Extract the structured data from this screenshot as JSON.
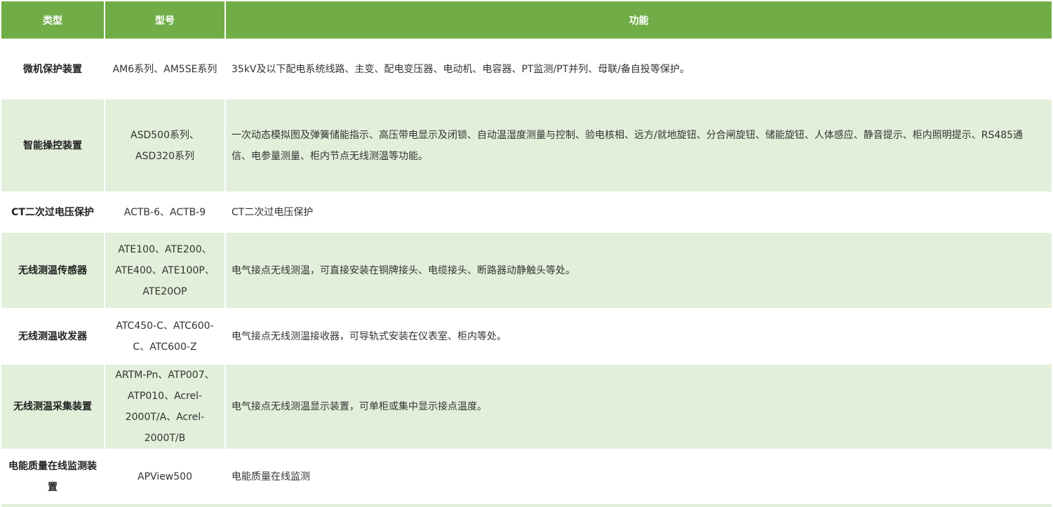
{
  "header": {
    "type": "类型",
    "model": "型号",
    "function": "功能"
  },
  "rows": [
    {
      "type": "微机保护装置",
      "model": "AM6系列、AM5SE系列",
      "function": "35kV及以下配电系统线路、主变、配电变压器、电动机、电容器、PT监测/PT并列、母联/备自投等保护。"
    },
    {
      "type": "智能操控装置",
      "model": "ASD500系列、ASD320系列",
      "function": "一次动态模拟图及弹簧储能指示、高压带电显示及闭锁、自动温湿度测量与控制、验电核相、远方/就地旋钮、分合闸旋钮、储能旋钮、人体感应、静音提示、柜内照明提示、RS485通信、电参量测量、柜内节点无线测温等功能。"
    },
    {
      "type": "CT二次过电压保护",
      "model": "ACTB-6、ACTB-9",
      "function": "CT二次过电压保护"
    },
    {
      "type": "无线测温传感器",
      "model": "ATE100、ATE200、ATE400、ATE100P、ATE20OP",
      "function": "电气接点无线测温，可直接安装在铜牌接头、电缆接头、断路器动静触头等处。"
    },
    {
      "type": "无线测温收发器",
      "model": "ATC450-C、ATC600-C、ATC600-Z",
      "function": "电气接点无线测温接收器，可导轨式安装在仪表室、柜内等处。"
    },
    {
      "type": "无线测温采集装置",
      "model": "ARTM-Pn、ATP007、ATP010、Acrel-2000T/A、Acrel-2000T/B",
      "function": "电气接点无线测温显示装置，可单柜或集中显示接点温度。"
    },
    {
      "type": "电能质量在线监测装置",
      "model": "APView500",
      "function": "电能质量在线监测"
    }
  ],
  "colors": {
    "header_bg": "#70ad47",
    "stripe_bg": "#e2efda"
  }
}
